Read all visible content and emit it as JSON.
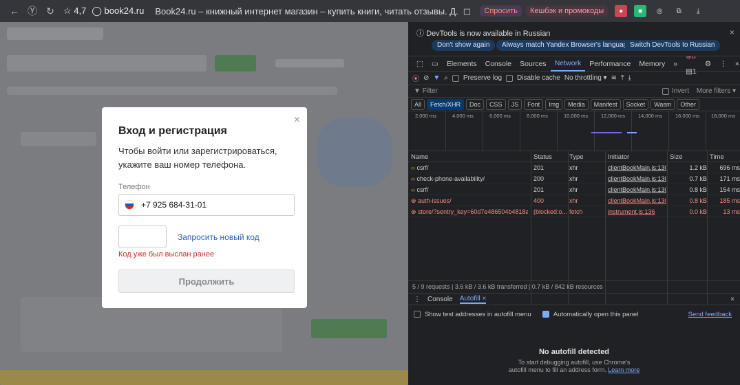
{
  "browser": {
    "rating": "4,7",
    "url": "book24.ru",
    "tab_title": "Book24.ru – книжный интернет магазин – купить книги, читать отзывы. Д...",
    "ask_label": "Спросить",
    "cashback_label": "Кешбэк и промокоды"
  },
  "modal": {
    "title": "Вход и регистрация",
    "description": "Чтобы войти или зарегистрироваться, укажите ваш номер телефона.",
    "phone_label": "Телефон",
    "phone_value": "+7 925 684-31-01",
    "resend_link": "Запросить новый код",
    "error_text": "Код уже был выслан ранее",
    "continue_button": "Продолжить",
    "close_icon": "×"
  },
  "devtools": {
    "infobar_text": "DevTools is now available in Russian",
    "btn_dont_show": "Don't show again",
    "btn_always_match": "Always match Yandex Browser's language",
    "btn_switch": "Switch DevTools to Russian",
    "tabs": [
      "Elements",
      "Console",
      "Sources",
      "Network",
      "Performance",
      "Memory"
    ],
    "active_tab": "Network",
    "errors_count": "8",
    "warnings_count": "1",
    "toolbar": {
      "preserve_log": "Preserve log",
      "disable_cache": "Disable cache",
      "throttling": "No throttling"
    },
    "filter_placeholder": "Filter",
    "invert_label": "Invert",
    "more_filters": "More filters",
    "chips": [
      "All",
      "Fetch/XHR",
      "Doc",
      "CSS",
      "JS",
      "Font",
      "Img",
      "Media",
      "Manifest",
      "Socket",
      "Wasm",
      "Other"
    ],
    "selected_chip": "Fetch/XHR",
    "timeline_labels": [
      "2,000 ms",
      "4,000 ms",
      "6,000 ms",
      "8,000 ms",
      "10,000 ms",
      "12,000 ms",
      "14,000 ms",
      "16,000 ms",
      "18,000 ms"
    ],
    "columns": [
      "Name",
      "Status",
      "Type",
      "Initiator",
      "Size",
      "Time"
    ],
    "rows": [
      {
        "name": "csrf/",
        "status": "201",
        "type": "xhr",
        "initiator": "clientBookMain.js:130",
        "size": "1.2 kB",
        "time": "696 ms",
        "error": false
      },
      {
        "name": "check-phone-availability/",
        "status": "200",
        "type": "xhr",
        "initiator": "clientBookMain.js:130",
        "size": "0.7 kB",
        "time": "171 ms",
        "error": false
      },
      {
        "name": "csrf/",
        "status": "201",
        "type": "xhr",
        "initiator": "clientBookMain.js:130",
        "size": "0.8 kB",
        "time": "154 ms",
        "error": false
      },
      {
        "name": "auth-issues/",
        "status": "400",
        "type": "xhr",
        "initiator": "clientBookMain.js:130",
        "size": "0.8 kB",
        "time": "185 ms",
        "error": true
      },
      {
        "name": "store/?sentry_key=60d7e486504b4818a...",
        "status": "(blocked:o...",
        "type": "fetch",
        "initiator": "instrument.js:136",
        "size": "0.0 kB",
        "time": "13 ms",
        "error": true
      }
    ],
    "summary": "5 / 9 requests  |  3.6 kB / 3.6 kB transferred  |  0.7 kB / 842 kB resources",
    "drawer_tabs": [
      "Console",
      "Autofill"
    ],
    "drawer_active": "Autofill",
    "show_test_addresses": "Show test addresses in autofill menu",
    "auto_open": "Automatically open this panel",
    "send_feedback": "Send feedback",
    "no_autofill_title": "No autofill detected",
    "no_autofill_desc_1": "To start debugging autofill, use Chrome's",
    "no_autofill_desc_2": "autofill menu to fill an address form.",
    "learn_more": "Learn more"
  },
  "colors": {
    "devtools_bg": "#202124",
    "accent_blue": "#7cacf8",
    "error_red": "#f28b82",
    "site_overlay": "#7a7c80"
  }
}
